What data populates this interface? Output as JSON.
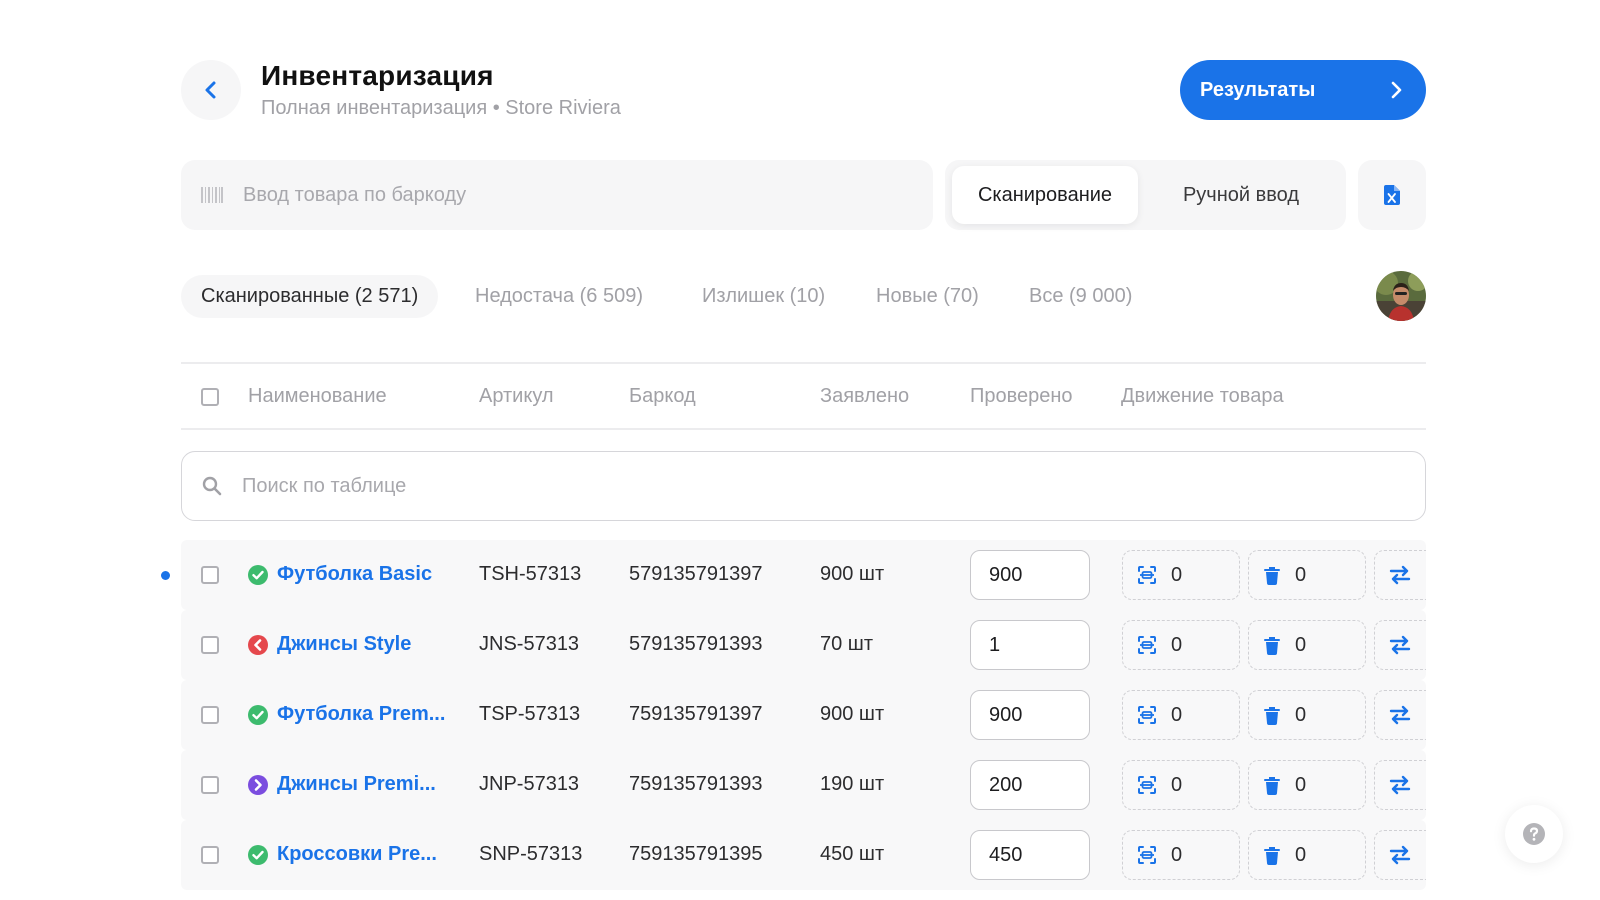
{
  "header": {
    "title": "Инвентаризация",
    "subtitle": "Полная инвентаризация • Store Riviera",
    "results_label": "Результаты"
  },
  "scan": {
    "barcode_placeholder": "Ввод товара по баркоду",
    "mode_scan": "Сканирование",
    "mode_manual": "Ручной ввод",
    "active_mode": "Сканирование"
  },
  "tabs": [
    {
      "label": "Сканированные (2 571)",
      "active": true
    },
    {
      "label": "Недостача (6 509)",
      "active": false
    },
    {
      "label": "Излишек (10)",
      "active": false
    },
    {
      "label": "Новые (70)",
      "active": false
    },
    {
      "label": "Все (9 000)",
      "active": false
    }
  ],
  "table": {
    "columns": {
      "name": "Наименование",
      "sku": "Артикул",
      "barcode": "Баркод",
      "declared": "Заявлено",
      "checked": "Проверено",
      "movement": "Движение товара"
    },
    "search_placeholder": "Поиск по таблице",
    "rows": [
      {
        "name": "Футболка Basic",
        "status": "ok",
        "sku": "TSH-57313",
        "barcode": "579135791397",
        "declared": "900 шт",
        "checked": "900",
        "moved": "0",
        "written_off": "0"
      },
      {
        "name": "Джинсы Style",
        "status": "shortage",
        "sku": "JNS-57313",
        "barcode": "579135791393",
        "declared": "70 шт",
        "checked": "1",
        "moved": "0",
        "written_off": "0"
      },
      {
        "name": "Футболка Prem...",
        "status": "ok",
        "sku": "TSP-57313",
        "barcode": "759135791397",
        "declared": "900 шт",
        "checked": "900",
        "moved": "0",
        "written_off": "0"
      },
      {
        "name": "Джинсы Premi...",
        "status": "surplus",
        "sku": "JNP-57313",
        "barcode": "759135791393",
        "declared": "190 шт",
        "checked": "200",
        "moved": "0",
        "written_off": "0"
      },
      {
        "name": "Кроссовки Pre...",
        "status": "ok",
        "sku": "SNP-57313",
        "barcode": "759135791395",
        "declared": "450 шт",
        "checked": "450",
        "moved": "0",
        "written_off": "0"
      }
    ]
  },
  "colors": {
    "accent": "#1a73e8",
    "ok": "#3dbb6e",
    "shortage": "#e5484d",
    "surplus": "#7b4ddf"
  },
  "icons": {
    "back": "chevron-left-icon",
    "results": "chevron-right-icon",
    "barcode": "barcode-icon",
    "excel": "excel-file-icon",
    "search": "search-icon",
    "move": "scan-frame-icon",
    "writeoff": "trash-icon",
    "transfer": "transfer-arrows-icon",
    "help": "question-icon"
  }
}
